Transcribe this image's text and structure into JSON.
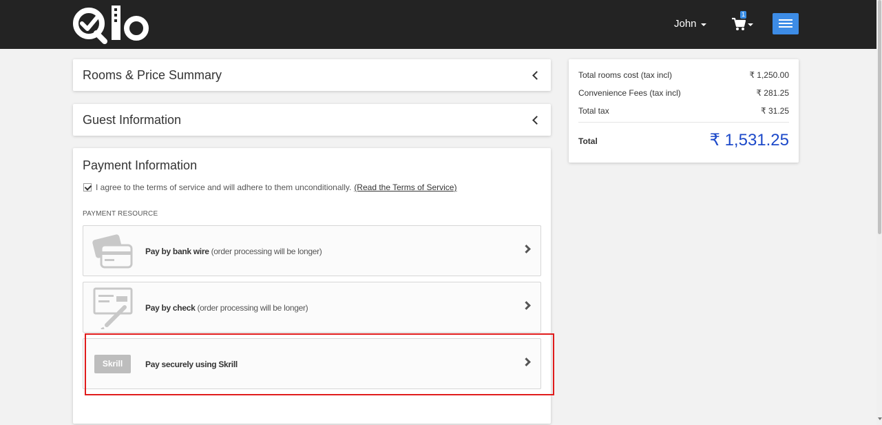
{
  "header": {
    "logo_alt": "Qlo",
    "user_name": "John",
    "cart_count": "1",
    "accent_color": "#3d8ce6"
  },
  "accordion": {
    "rooms_title": "Rooms & Price Summary",
    "guest_title": "Guest Information"
  },
  "payment": {
    "title": "Payment Information",
    "terms_text": "I agree to the terms of service and will adhere to them unconditionally.",
    "terms_link": "(Read the Terms of Service)",
    "terms_checked": true,
    "section_label": "PAYMENT RESOURCE",
    "options": [
      {
        "bold": "Pay by bank wire",
        "text": " (order processing will be longer)",
        "icon": "bank-card-icon"
      },
      {
        "bold": "Pay by check",
        "text": " (order processing will be longer)",
        "icon": "check-pen-icon"
      },
      {
        "bold": "Pay securely using Skrill",
        "text": "",
        "icon": "skrill-logo",
        "logo_text": "Skrill",
        "highlighted": true
      }
    ]
  },
  "summary": {
    "rows": [
      {
        "label": "Total rooms cost (tax incl)",
        "value": "₹ 1,250.00"
      },
      {
        "label": "Convenience Fees (tax incl)",
        "value": "₹ 281.25"
      },
      {
        "label": "Total tax",
        "value": "₹ 31.25"
      }
    ],
    "total_label": "Total",
    "total_value": "₹ 1,531.25",
    "total_color": "#1c49c9"
  }
}
